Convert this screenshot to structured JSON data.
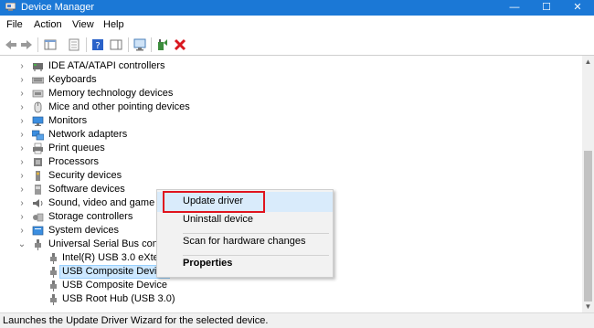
{
  "window": {
    "title": "Device Manager",
    "minimize": "—",
    "maximize": "☐",
    "close": "✕"
  },
  "menu": {
    "file": "File",
    "action": "Action",
    "view": "View",
    "help": "Help"
  },
  "tree": {
    "rows": [
      {
        "label": "IDE ATA/ATAPI controllers"
      },
      {
        "label": "Keyboards"
      },
      {
        "label": "Memory technology devices"
      },
      {
        "label": "Mice and other pointing devices"
      },
      {
        "label": "Monitors"
      },
      {
        "label": "Network adapters"
      },
      {
        "label": "Print queues"
      },
      {
        "label": "Processors"
      },
      {
        "label": "Security devices"
      },
      {
        "label": "Software devices"
      },
      {
        "label": "Sound, video and game cc"
      },
      {
        "label": "Storage controllers"
      },
      {
        "label": "System devices"
      },
      {
        "label": "Universal Serial Bus contro"
      },
      {
        "label": "Intel(R) USB 3.0 eXtensi"
      },
      {
        "label": "USB Composite Device"
      },
      {
        "label": "USB Composite Device"
      },
      {
        "label": "USB Root Hub (USB 3.0)"
      }
    ]
  },
  "context_menu": {
    "update_driver": "Update driver",
    "uninstall_device": "Uninstall device",
    "scan": "Scan for hardware changes",
    "properties": "Properties"
  },
  "status": {
    "text": "Launches the Update Driver Wizard for the selected device."
  },
  "colors": {
    "titlebar": "#1b78d6",
    "highlight_box": "#e0141e",
    "selection": "#cde8ff"
  }
}
